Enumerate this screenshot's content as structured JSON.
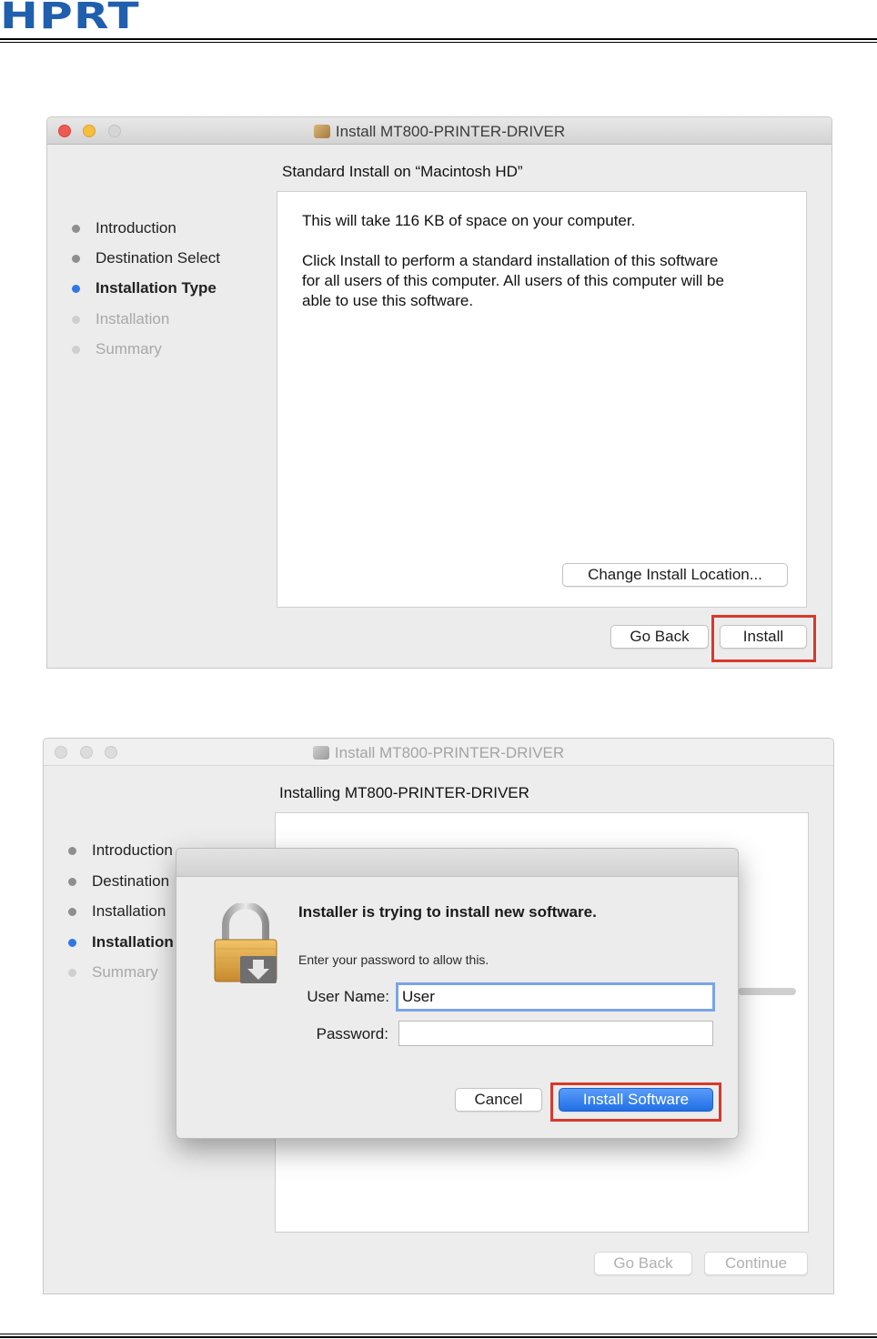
{
  "doc": {
    "logo": "HPRT"
  },
  "window1": {
    "title": "Install MT800-PRINTER-DRIVER",
    "heading": "Standard Install on “Macintosh HD”",
    "steps": [
      {
        "label": "Introduction",
        "state": "done"
      },
      {
        "label": "Destination Select",
        "state": "done"
      },
      {
        "label": "Installation Type",
        "state": "active"
      },
      {
        "label": "Installation",
        "state": "pending"
      },
      {
        "label": "Summary",
        "state": "pending"
      }
    ],
    "body_line1": "This will take 116 KB of space on your computer.",
    "body_line2": "Click Install to perform a standard installation of this software",
    "body_line3": "for all users of this computer. All users of this computer will be",
    "body_line4": "able to use this software.",
    "change_location_label": "Change Install Location...",
    "go_back_label": "Go Back",
    "install_label": "Install"
  },
  "window2": {
    "title": "Install MT800-PRINTER-DRIVER",
    "heading": "Installing MT800-PRINTER-DRIVER",
    "steps": [
      {
        "label": "Introduction",
        "state": "done"
      },
      {
        "label": "Destination",
        "state": "done"
      },
      {
        "label": "Installation",
        "state": "done"
      },
      {
        "label": "Installation",
        "state": "active"
      },
      {
        "label": "Summary",
        "state": "pending"
      }
    ],
    "go_back_label": "Go Back",
    "continue_label": "Continue"
  },
  "auth_dialog": {
    "title": "Installer is trying to install new software.",
    "subtitle": "Enter your password to allow this.",
    "username_label": "User Name:",
    "username_value": "User",
    "password_label": "Password:",
    "password_value": "",
    "cancel_label": "Cancel",
    "install_software_label": "Install Software"
  },
  "colors": {
    "close": "#ee5a52",
    "minimize": "#f5be3f",
    "zoom_inactive": "#d6d6d6",
    "active_step": "#2f78e6",
    "highlight": "#d9392b",
    "primary_button": "#1f6fe6"
  },
  "icons": {
    "package": "package-icon",
    "lock": "lock-icon"
  }
}
